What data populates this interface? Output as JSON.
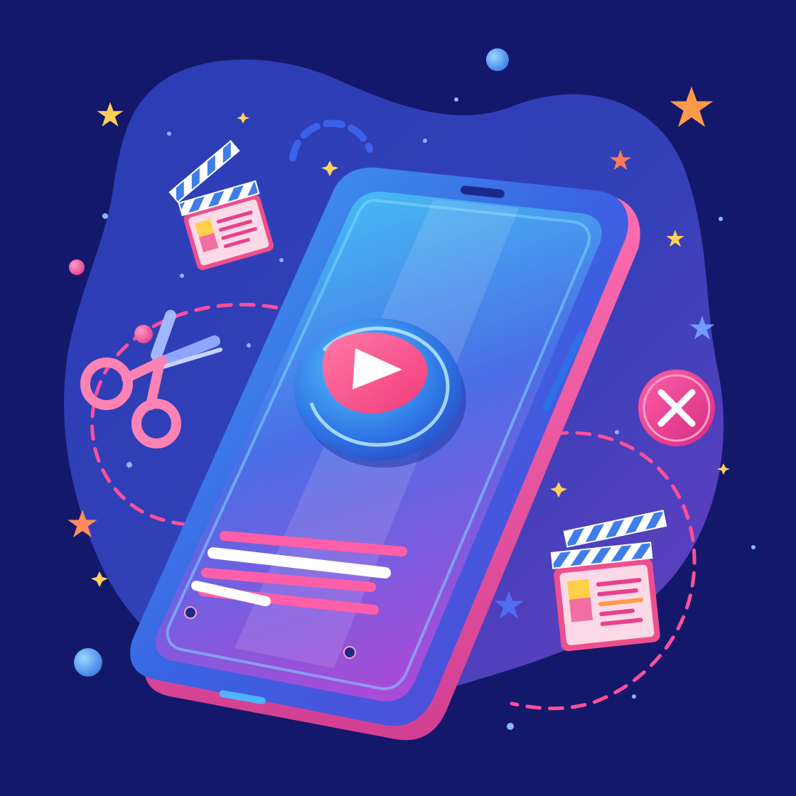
{
  "illustration": {
    "subject": "smartphone-video-editing",
    "icons": [
      "play-icon",
      "scissors-icon",
      "clapperboard-icon",
      "close-icon",
      "star-icon",
      "dot-icon"
    ]
  },
  "palette": {
    "background": "#14186a",
    "blob_start": "#2c3fb8",
    "blob_end": "#6a3fc0",
    "phone_body": "#3a6ee8",
    "phone_edge": "#e34f9a",
    "screen_top": "#3fb4f2",
    "screen_bottom": "#a445d4",
    "accent_pink": "#ff4f9c",
    "accent_blue": "#4fa0ff",
    "accent_orange": "#ff9a4a",
    "accent_yellow": "#ffd25a",
    "text_line": "#ffffff"
  }
}
